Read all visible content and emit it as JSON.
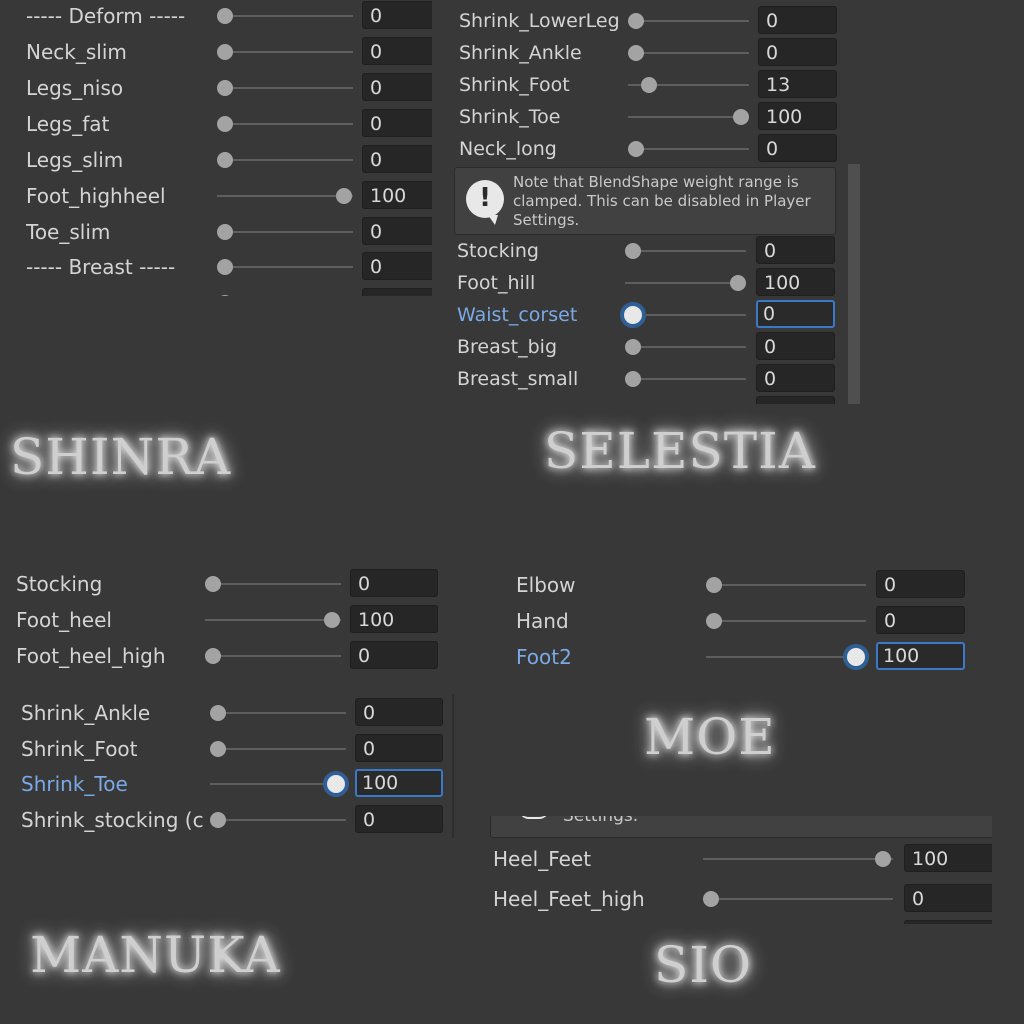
{
  "titles": {
    "shinra": "SHINRA",
    "selestia": "SELESTIA",
    "manuka": "MANUKA",
    "moe": "MOE",
    "sio": "SIO"
  },
  "shinra_panel": {
    "rows": [
      {
        "label": "----- Deform -----",
        "value": "0"
      },
      {
        "label": "Neck_slim",
        "value": "0"
      },
      {
        "label": "Legs_niso",
        "value": "0"
      },
      {
        "label": "Legs_fat",
        "value": "0"
      },
      {
        "label": "Legs_slim",
        "value": "0"
      },
      {
        "label": "Foot_highheel",
        "value": "100"
      },
      {
        "label": "Toe_slim",
        "value": "0"
      },
      {
        "label": "----- Breast -----",
        "value": "0"
      }
    ]
  },
  "selestia_panel": {
    "rows_top": [
      {
        "label": "Shrink_LowerLeg",
        "value": "0"
      },
      {
        "label": "Shrink_Ankle",
        "value": "0"
      },
      {
        "label": "Shrink_Foot",
        "value": "13"
      },
      {
        "label": "Shrink_Toe",
        "value": "100"
      },
      {
        "label": "Neck_long",
        "value": "0"
      }
    ],
    "note": "Note that BlendShape weight range is clamped. This can be disabled in Player Settings.",
    "rows_bottom": [
      {
        "label": "Stocking",
        "value": "0"
      },
      {
        "label": "Foot_hill",
        "value": "100"
      },
      {
        "label": "Waist_corset",
        "value": "0"
      },
      {
        "label": "Breast_big",
        "value": "0"
      },
      {
        "label": "Breast_small",
        "value": "0"
      }
    ]
  },
  "manuka_panel": {
    "rows_top": [
      {
        "label": "Stocking",
        "value": "0"
      },
      {
        "label": "Foot_heel",
        "value": "100"
      },
      {
        "label": "Foot_heel_high",
        "value": "0"
      }
    ],
    "rows_bottom": [
      {
        "label": "Shrink_Ankle",
        "value": "0"
      },
      {
        "label": "Shrink_Foot",
        "value": "0"
      },
      {
        "label": "Shrink_Toe",
        "value": "100"
      },
      {
        "label": "Shrink_stocking (c",
        "value": "0"
      }
    ]
  },
  "moe_panel": {
    "rows": [
      {
        "label": "Elbow",
        "value": "0"
      },
      {
        "label": "Hand",
        "value": "0"
      },
      {
        "label": "Foot2",
        "value": "100"
      }
    ]
  },
  "sio_panel": {
    "note_tail": "Settings.",
    "rows": [
      {
        "label": "Heel_Feet",
        "value": "100"
      },
      {
        "label": "Heel_Feet_high",
        "value": "0"
      }
    ]
  },
  "colors": {
    "background": "#383838",
    "field": "#262626",
    "active_blue": "#3a79c8",
    "active_label": "#7aa9e6"
  },
  "slider_levels": {
    "shinra": [
      0,
      0,
      0,
      0,
      0,
      100,
      0,
      0
    ],
    "selestia_top": [
      0,
      0,
      13,
      100,
      0
    ],
    "selestia_bottom": [
      0,
      100,
      0,
      0,
      0
    ],
    "manuka_top": [
      0,
      100,
      0
    ],
    "manuka_bottom": [
      0,
      0,
      100,
      0
    ],
    "moe": [
      0,
      0,
      100
    ],
    "sio": [
      100,
      0
    ]
  }
}
